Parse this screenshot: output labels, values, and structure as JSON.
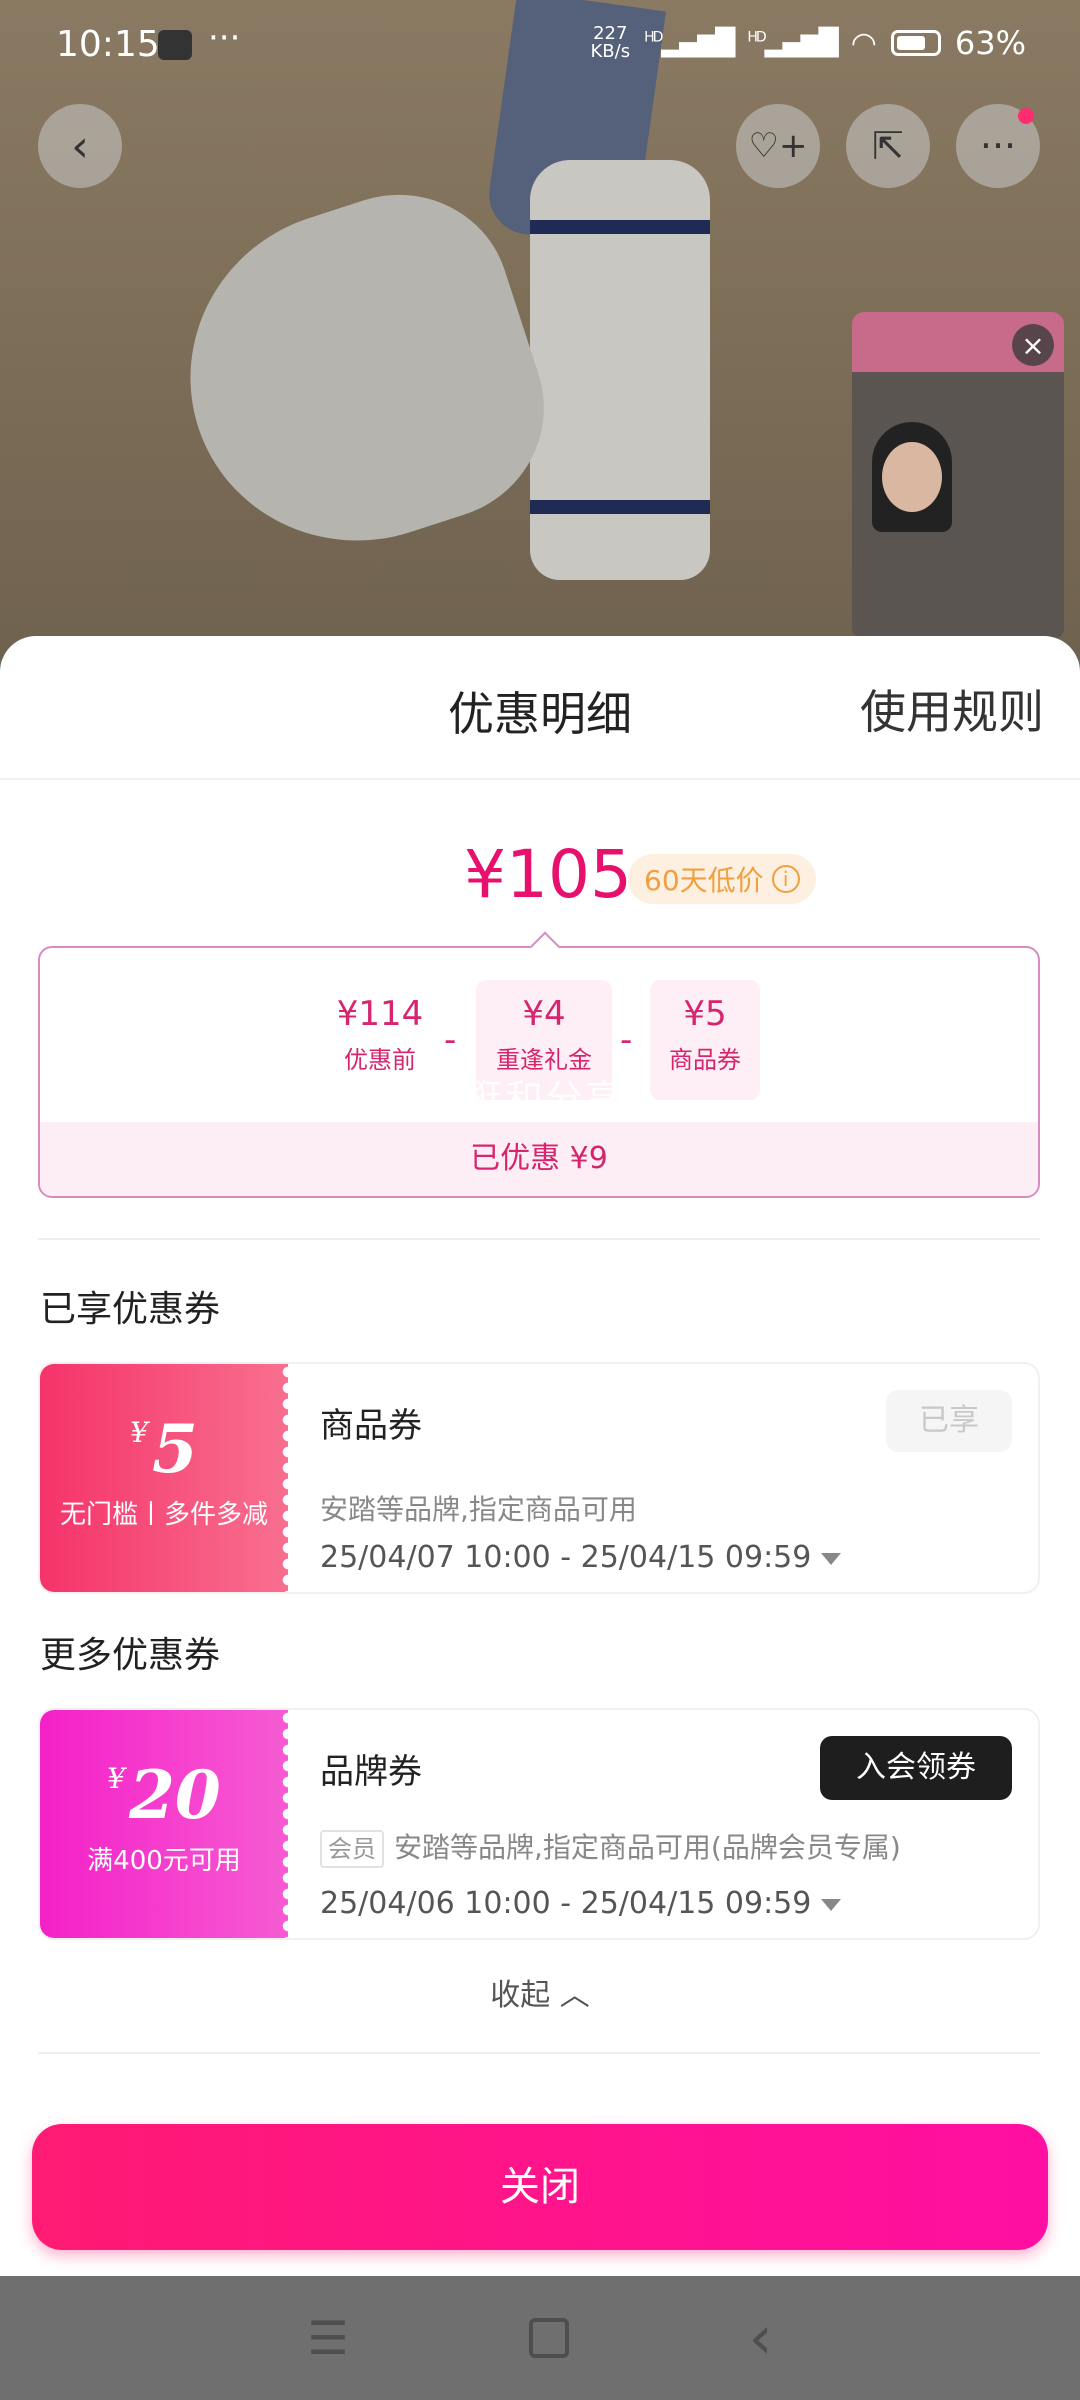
{
  "status_bar": {
    "time": "10:15",
    "dots": "···",
    "net_speed_value": "227",
    "net_speed_unit": "KB/s",
    "signal_1": "HD",
    "signal_2": "HD",
    "battery": "63%"
  },
  "top_actions": {
    "back_icon": "‹",
    "favorite_icon": "♡+",
    "share_icon": "⇱",
    "more_icon": "···"
  },
  "sheet": {
    "title": "优惠明细",
    "rules_link": "使用规则",
    "final_price": "¥105",
    "low_price_badge": "60天低价",
    "info_icon": "i",
    "calc": {
      "items": [
        {
          "value": "¥114",
          "label": "优惠前"
        },
        {
          "value": "¥4",
          "label": "重逢礼金"
        },
        {
          "value": "¥5",
          "label": "商品券"
        }
      ],
      "op": "-",
      "total": "已优惠 ¥9",
      "watermark": "京东逛和分享"
    },
    "enjoyed_section_title": "已享优惠券",
    "more_section_title": "更多优惠券",
    "coupons": [
      {
        "yen": "¥",
        "amount": "5",
        "condition": "无门槛丨多件多减",
        "name": "商品券",
        "status": "已享",
        "desc": "安踏等品牌,指定商品可用",
        "time": "25/04/07 10:00 - 25/04/15 09:59"
      },
      {
        "yen": "¥",
        "amount": "20",
        "condition": "满400元可用",
        "name": "品牌券",
        "action": "入会领券",
        "member_tag": "会员",
        "desc": "安踏等品牌,指定商品可用(品牌会员专属)",
        "time": "25/04/06 10:00 - 25/04/15 09:59"
      }
    ],
    "collapse_label": "收起",
    "collapse_icon": "︿",
    "close_button": "关闭"
  },
  "nav": {
    "menu_icon": "☰",
    "back_icon": "‹"
  },
  "colors": {
    "accent": "#e8106d",
    "badge": "#f0a040",
    "button_gradient_start": "#ff1a73",
    "button_gradient_end": "#ff0fa2"
  }
}
